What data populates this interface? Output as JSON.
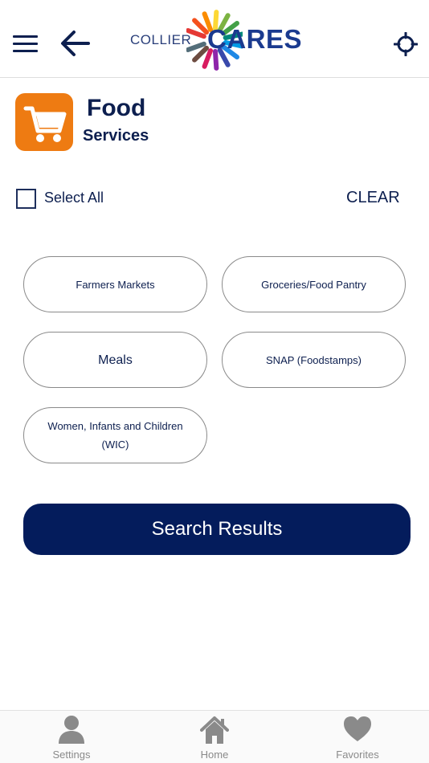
{
  "header": {
    "menu_icon": "hamburger-menu-icon",
    "back_icon": "arrow-left-icon",
    "logo": {
      "small": "COLLIER",
      "big": "CARES"
    },
    "location_icon": "crosshair-icon"
  },
  "category": {
    "icon": "shopping-cart-icon",
    "icon_color": "#EE7B12",
    "title": "Food",
    "subtitle": "Services"
  },
  "select_all": {
    "label": "Select All",
    "checked": false
  },
  "clear_label": "CLEAR",
  "options": [
    {
      "label": "Farmers Markets"
    },
    {
      "label": "Groceries/Food Pantry"
    },
    {
      "label": "Meals"
    },
    {
      "label": "SNAP (Foodstamps)"
    },
    {
      "label": "Women, Infants and Children (WIC)"
    }
  ],
  "search_button": {
    "label": "Search Results",
    "color": "#041C5C"
  },
  "bottom_nav": [
    {
      "label": "Settings",
      "icon": "person-icon"
    },
    {
      "label": "Home",
      "icon": "home-icon"
    },
    {
      "label": "Favorites",
      "icon": "heart-icon"
    }
  ],
  "colors": {
    "primary": "#0D1F4F",
    "accent": "#EE7B12",
    "nav_gray": "#8A8A8A"
  }
}
